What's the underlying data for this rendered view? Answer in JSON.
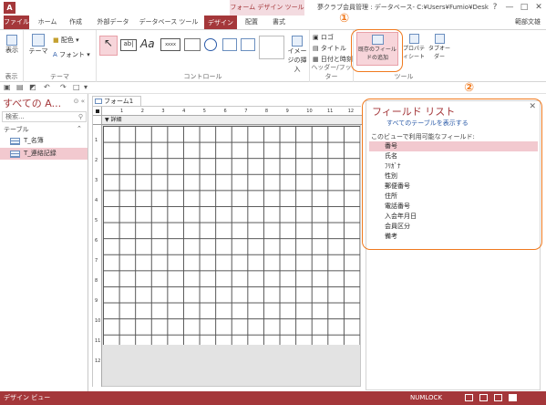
{
  "title_bar": {
    "app_icon_letter": "A",
    "context_tab_title": "フォーム デザイン ツール",
    "window_title": "夢クラブ会員管理 : データベース- C:¥Users¥Fumio¥Desktop¥...",
    "help": "?",
    "minimize": "—",
    "maximize": "□",
    "close": "✕"
  },
  "tabs": {
    "file": "ファイル",
    "home": "ホーム",
    "create": "作成",
    "external": "外部データ",
    "dbtools": "データベース ツール",
    "design": "デザイン",
    "arrange": "配置",
    "format": "書式",
    "user": "範部文雄"
  },
  "ribbon": {
    "views": {
      "label": "表示",
      "btn": "表示"
    },
    "themes": {
      "label": "テーマ",
      "theme": "テーマ",
      "colors": "配色",
      "fonts": "フォント"
    },
    "controls": {
      "label": "コントロール",
      "image": "イメージの挿入"
    },
    "header_footer": {
      "label": "ヘッダー/フッター",
      "logo": "ロゴ",
      "title": "タイトル",
      "datetime": "日付と時刻"
    },
    "tools": {
      "label": "ツール",
      "add_fields": "既存のフィールドの追加",
      "property": "プロパティシート",
      "tab_order": "タブオーダー"
    }
  },
  "nav": {
    "title": "すべての A...",
    "search_placeholder": "検索...",
    "section": "テーブル",
    "items": [
      "T_名簿",
      "T_連絡記録"
    ]
  },
  "document": {
    "tab": "フォーム1",
    "section": "詳細",
    "ruler_h": [
      "1",
      "2",
      "3",
      "4",
      "5",
      "6",
      "7",
      "8",
      "9",
      "10",
      "11",
      "12"
    ],
    "ruler_v": [
      "1",
      "2",
      "3",
      "4",
      "5",
      "6",
      "7",
      "8",
      "9",
      "10",
      "11",
      "12"
    ]
  },
  "field_list": {
    "title": "フィールド リスト",
    "show_all": "すべてのテーブルを表示する",
    "subtitle": "このビューで利用可能なフィールド:",
    "fields": [
      "番号",
      "氏名",
      "ﾌﾘｶﾞﾅ",
      "性別",
      "郵便番号",
      "住所",
      "電話番号",
      "入会年月日",
      "会員区分",
      "備考"
    ]
  },
  "annotations": {
    "one": "①",
    "two": "②"
  },
  "status": {
    "left": "デザイン ビュー",
    "numlock": "NUMLOCK"
  },
  "colors": {
    "accent": "#a4373a",
    "annotation": "#f07a1f",
    "selection": "#f2c9cf"
  }
}
